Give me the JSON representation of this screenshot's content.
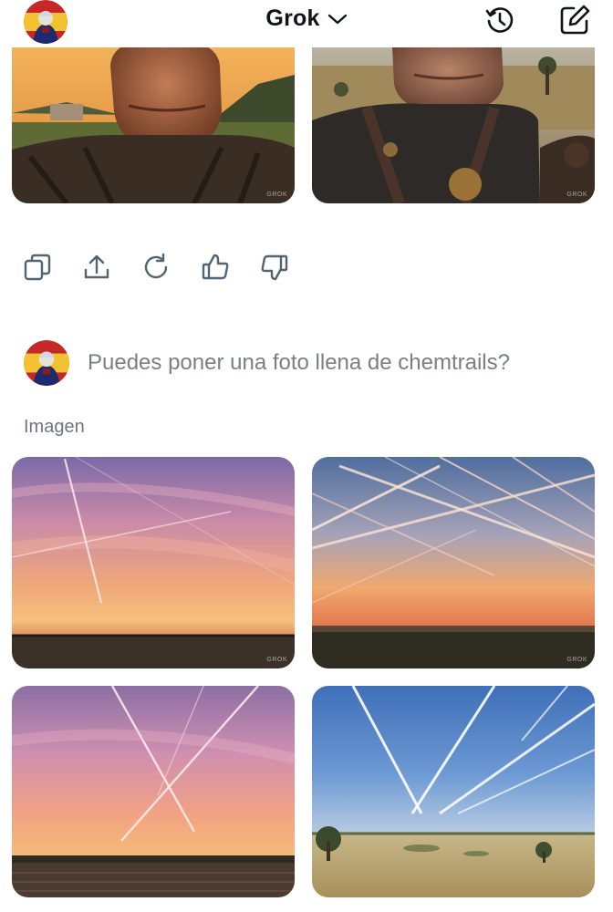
{
  "header": {
    "title": "Grok",
    "avatar_icon": "user-avatar",
    "dropdown_icon": "chevron-down-icon",
    "history_icon": "history-icon",
    "new_chat_icon": "edit-icon"
  },
  "actions": [
    {
      "icon": "copy-icon"
    },
    {
      "icon": "share-icon"
    },
    {
      "icon": "regenerate-icon"
    },
    {
      "icon": "thumbs-up-icon"
    },
    {
      "icon": "thumbs-down-icon"
    }
  ],
  "message": {
    "prompt": "Puedes poner una foto llena de chemtrails?"
  },
  "response": {
    "label": "Imagen"
  },
  "watermark": "GROK",
  "colors": {
    "text": "#0f1419",
    "muted": "#6e767d",
    "background": "#ffffff"
  }
}
